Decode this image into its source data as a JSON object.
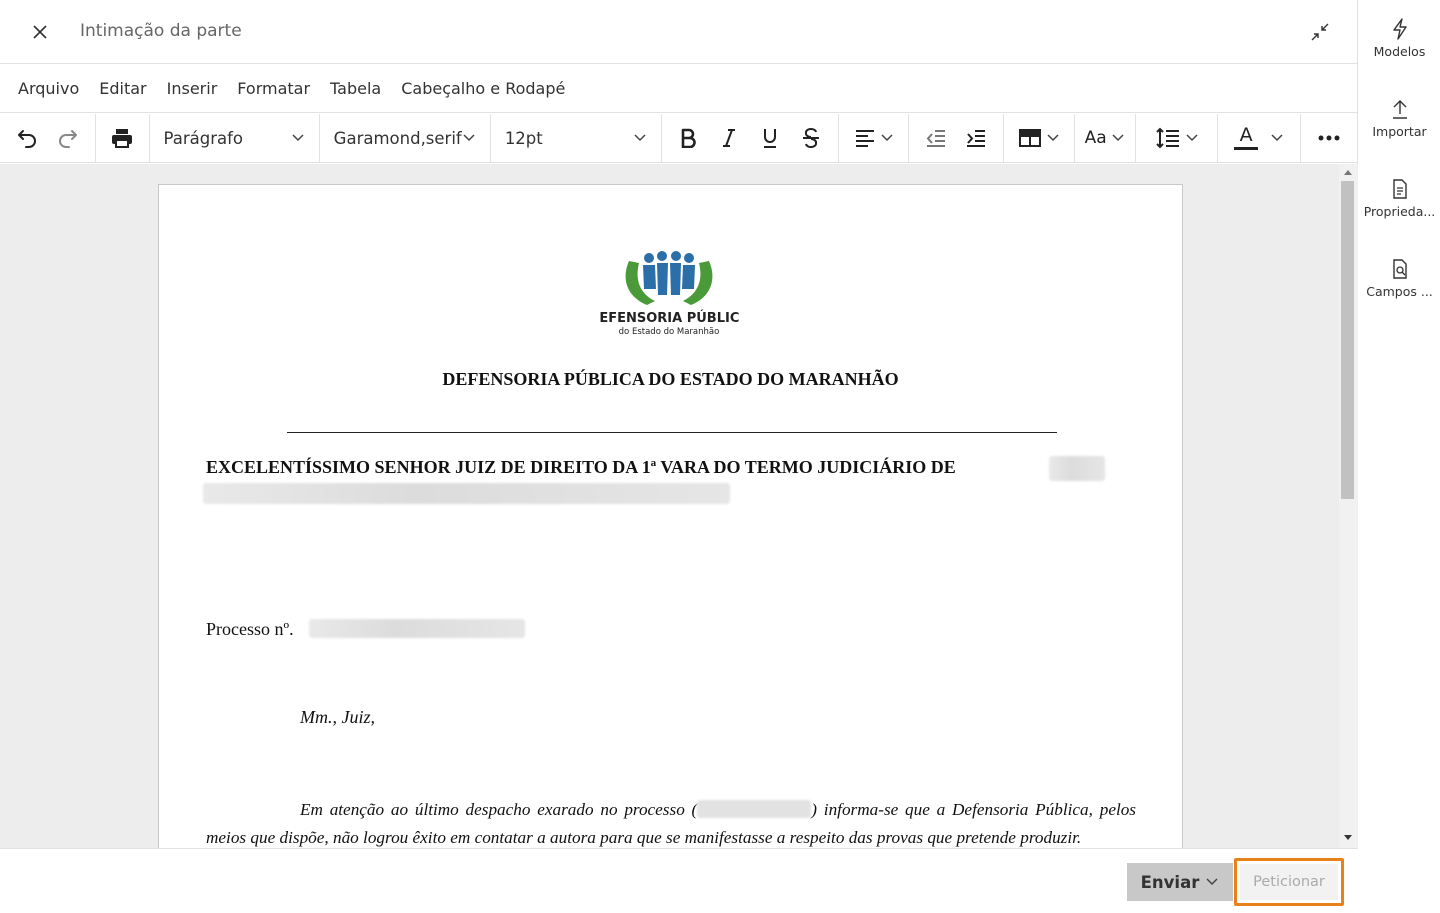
{
  "window": {
    "title": "Intimação da parte"
  },
  "menubar": {
    "items": [
      "Arquivo",
      "Editar",
      "Inserir",
      "Formatar",
      "Tabela",
      "Cabeçalho e Rodapé"
    ]
  },
  "toolbar": {
    "paragraph_style": "Parágrafo",
    "font_family": "Garamond,serif",
    "font_size": "12pt",
    "font_case_label": "Aa",
    "text_color_label": "A"
  },
  "document": {
    "logo_title": "DEFENSORIA PÚBLICA",
    "logo_subtitle": "do Estado do Maranhão",
    "org_heading": "DEFENSORIA PÚBLICA DO ESTADO DO MARANHÃO",
    "addressee": "EXCELENTÍSSIMO SENHOR JUIZ DE DIREITO DA 1ª VARA DO TERMO JUDICIÁRIO DE",
    "process_label": "Processo nº.",
    "salutation": "Mm., Juiz,",
    "body_part1": "Em atenção ao último despacho exarado no processo (",
    "body_part2": ") informa-se que a Defensoria Pública, pelos meios que dispõe, não logrou êxito em contatar a autora para que se manifestasse a respeito das provas que pretende produzir."
  },
  "footer": {
    "send_label": "Enviar",
    "petition_label": "Peticionar"
  },
  "sidebar": {
    "items": [
      {
        "label": "Modelos",
        "icon": "lightning-icon"
      },
      {
        "label": "Importar",
        "icon": "upload-icon"
      },
      {
        "label": "Proprieda...",
        "icon": "document-list-icon"
      },
      {
        "label": "Campos ...",
        "icon": "document-search-icon"
      }
    ]
  },
  "colors": {
    "accent_highlight": "#e8811a",
    "logo_green": "#4a9a3a",
    "logo_blue": "#2c6fa8"
  }
}
